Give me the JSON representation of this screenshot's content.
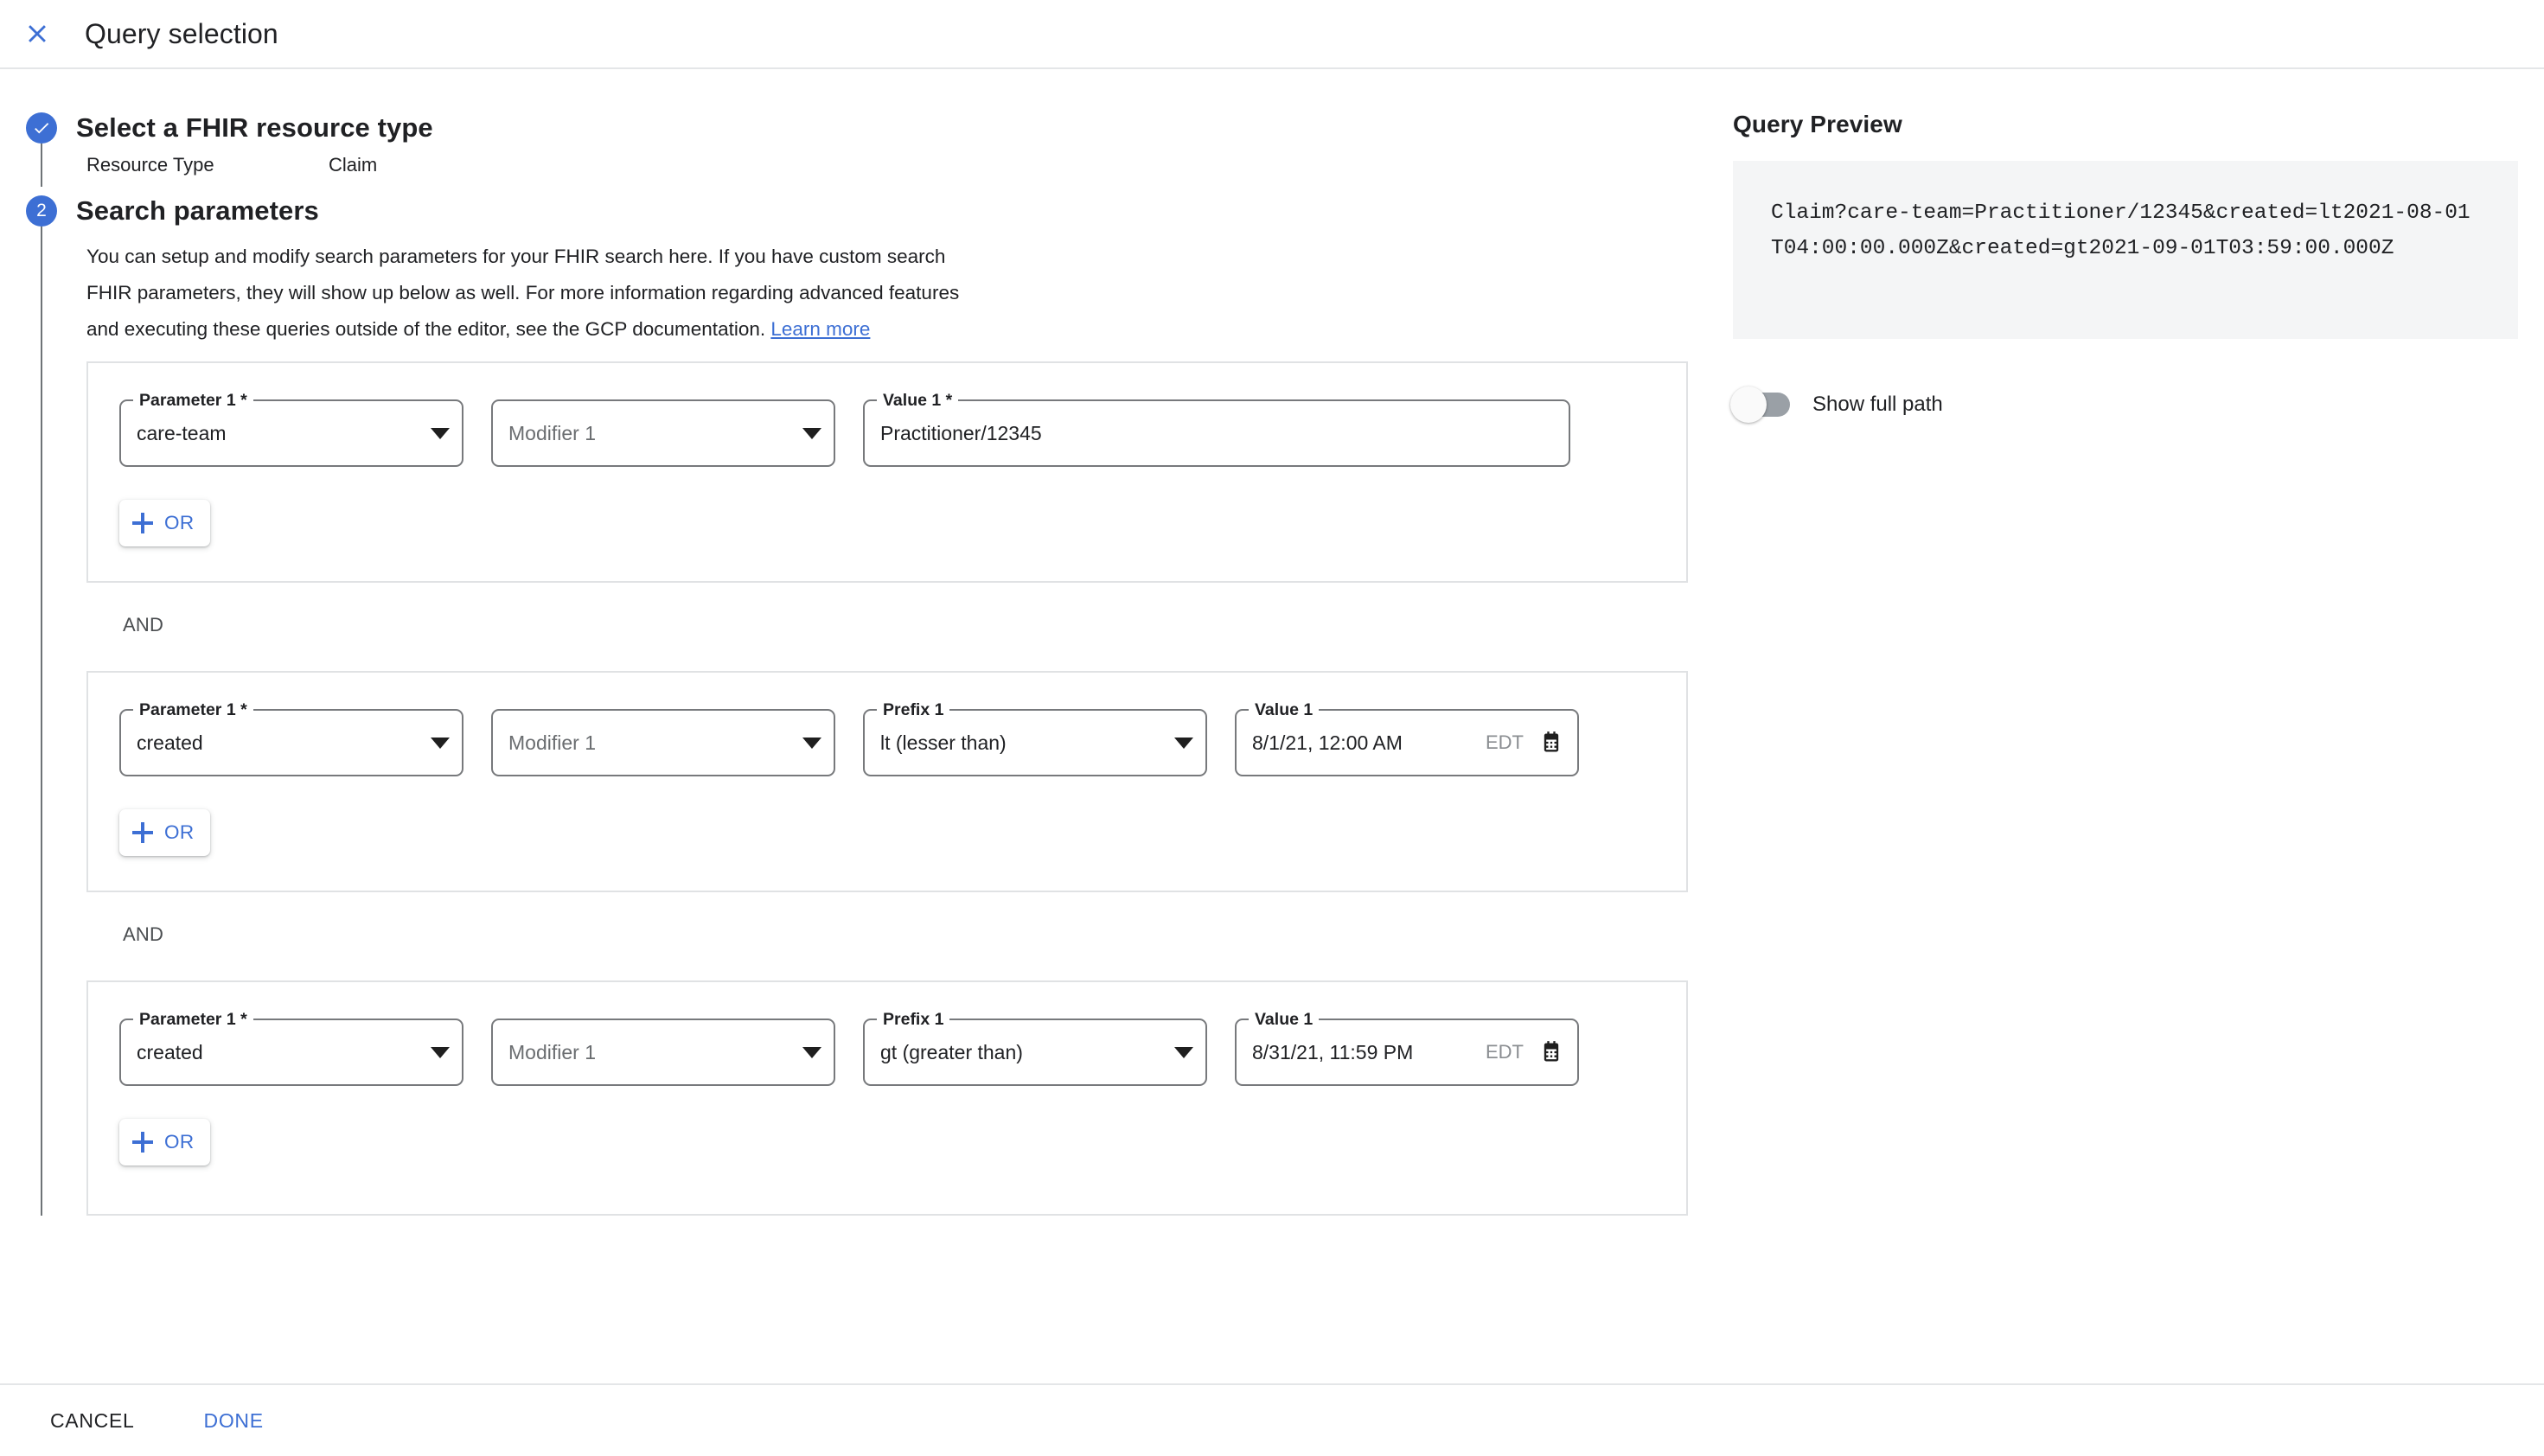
{
  "header": {
    "close_icon": "close-icon",
    "title": "Query selection"
  },
  "steps": [
    {
      "id": "select-resource-type",
      "indicator": "check",
      "title": "Select a FHIR resource type",
      "resource_label": "Resource Type",
      "resource_value": "Claim"
    },
    {
      "id": "search-parameters",
      "indicator": "2",
      "title": "Search parameters",
      "description_part1": "You can setup and modify search parameters for your FHIR search here. If you have custom search FHIR parameters, they will show up below as well. For more information regarding advanced features and executing these queries outside of the editor, see the GCP documentation. ",
      "learn_more": "Learn more"
    }
  ],
  "parameter_groups": [
    {
      "parameter_label": "Parameter 1 *",
      "parameter_value": "care-team",
      "modifier_label": "Modifier 1",
      "modifier_value": "Modifier 1",
      "value_label": "Value 1 *",
      "value_value": "Practitioner/12345",
      "or_label": "OR"
    },
    {
      "parameter_label": "Parameter 1 *",
      "parameter_value": "created",
      "modifier_label": "Modifier 1",
      "modifier_value": "Modifier 1",
      "prefix_label": "Prefix 1",
      "prefix_value": "lt (lesser than)",
      "value_label": "Value 1",
      "value_value": "8/1/21, 12:00 AM",
      "timezone": "EDT",
      "or_label": "OR"
    },
    {
      "parameter_label": "Parameter 1 *",
      "parameter_value": "created",
      "modifier_label": "Modifier 1",
      "modifier_value": "Modifier 1",
      "prefix_label": "Prefix 1",
      "prefix_value": "gt (greater than)",
      "value_label": "Value 1",
      "value_value": "8/31/21, 11:59 PM",
      "timezone": "EDT",
      "or_label": "OR"
    }
  ],
  "separators": {
    "and": "AND"
  },
  "query_preview": {
    "title": "Query Preview",
    "query": "Claim?care-team=Practitioner/12345&created=lt2021-08-01T04:00:00.000Z&created=gt2021-09-01T03:59:00.000Z",
    "show_full_path_label": "Show full path",
    "show_full_path_state": "off"
  },
  "footer": {
    "cancel_label": "CANCEL",
    "done_label": "DONE"
  },
  "colors": {
    "accent": "#3d6fd4",
    "text": "#202124",
    "field_border": "#77797c",
    "card_border": "#e0e2e4",
    "preview_bg": "#f4f5f6",
    "switch_track_off": "#9aa0a6"
  }
}
